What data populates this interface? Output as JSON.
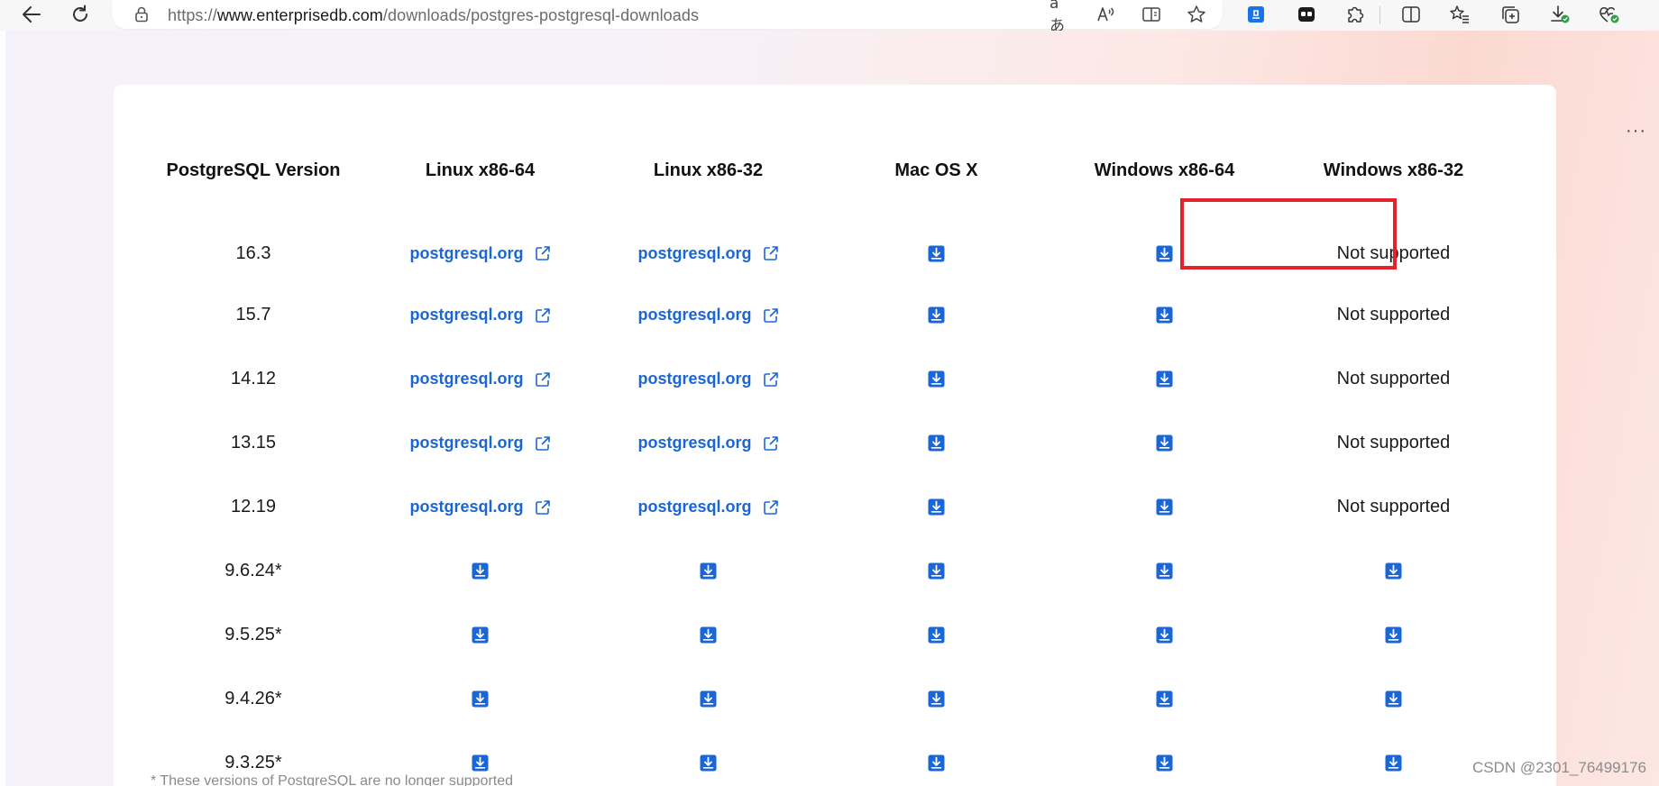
{
  "browser": {
    "url_prefix": "https://",
    "url_host": "www.enterprisedb.com",
    "url_path": "/downloads/postgres-postgresql-downloads",
    "read_aloud_label": "A⁾",
    "translate_label": "aあ"
  },
  "table": {
    "headers": [
      "PostgreSQL Version",
      "Linux x86-64",
      "Linux x86-32",
      "Mac OS X",
      "Windows x86-64",
      "Windows x86-32"
    ],
    "link_text": "postgresql.org",
    "not_supported_text": "Not supported",
    "rows": [
      {
        "version": "16.3"
      },
      {
        "version": "15.7"
      },
      {
        "version": "14.12"
      },
      {
        "version": "13.15"
      },
      {
        "version": "12.19"
      },
      {
        "version": "9.6.24*"
      },
      {
        "version": "9.5.25*"
      },
      {
        "version": "9.4.26*"
      },
      {
        "version": "9.3.25*"
      }
    ]
  },
  "footnote": "* These versions of PostgreSQL are no longer supported",
  "watermark": "CSDN @2301_76499176",
  "more_label": "···",
  "colors": {
    "link": "#1a66d6",
    "download_icon": "#1a66d6",
    "highlight": "#e3232b"
  }
}
